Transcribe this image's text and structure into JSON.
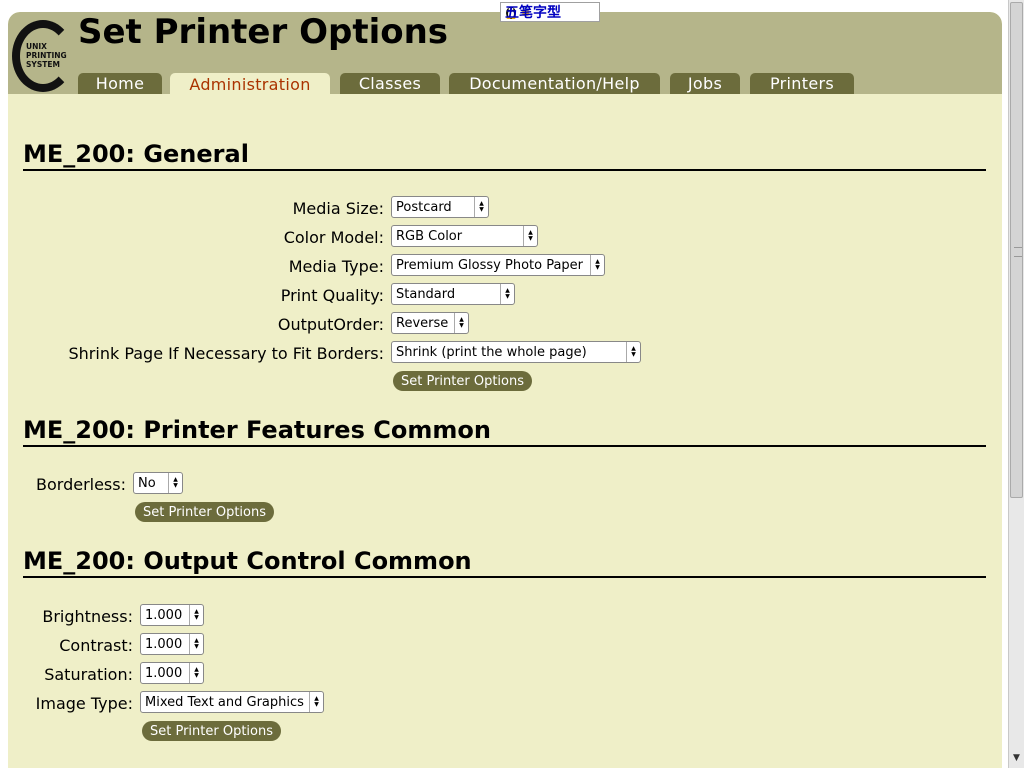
{
  "ime": {
    "label": "五笔字型"
  },
  "logo": {
    "lines": [
      "UNIX",
      "PRINTING",
      "SYSTEM"
    ]
  },
  "page": {
    "title": "Set Printer Options"
  },
  "tabs": [
    {
      "label": "Home",
      "active": false
    },
    {
      "label": "Administration",
      "active": true
    },
    {
      "label": "Classes",
      "active": false
    },
    {
      "label": "Documentation/Help",
      "active": false
    },
    {
      "label": "Jobs",
      "active": false
    },
    {
      "label": "Printers",
      "active": false
    }
  ],
  "sections": {
    "general": {
      "heading": "ME_200: General",
      "fields": [
        {
          "label": "Media Size:",
          "value": "Postcard"
        },
        {
          "label": "Color Model:",
          "value": "RGB Color"
        },
        {
          "label": "Media Type:",
          "value": "Premium Glossy Photo Paper"
        },
        {
          "label": "Print Quality:",
          "value": "Standard"
        },
        {
          "label": "OutputOrder:",
          "value": "Reverse"
        },
        {
          "label": "Shrink Page If Necessary to Fit Borders:",
          "value": "Shrink (print the whole page)"
        }
      ],
      "button": "Set Printer Options"
    },
    "features": {
      "heading": "ME_200: Printer Features Common",
      "fields": [
        {
          "label": "Borderless:",
          "value": "No"
        }
      ],
      "button": "Set Printer Options"
    },
    "output": {
      "heading": "ME_200: Output Control Common",
      "fields": [
        {
          "label": "Brightness:",
          "value": "1.000"
        },
        {
          "label": "Contrast:",
          "value": "1.000"
        },
        {
          "label": "Saturation:",
          "value": "1.000"
        },
        {
          "label": "Image Type:",
          "value": "Mixed Text and Graphics"
        }
      ],
      "button": "Set Printer Options"
    }
  },
  "colors": {
    "header": "#b5b58a",
    "background": "#efefc8",
    "tab": "#6c6c3c",
    "tab_active_text": "#aa3300",
    "button": "#6c6c3c"
  }
}
